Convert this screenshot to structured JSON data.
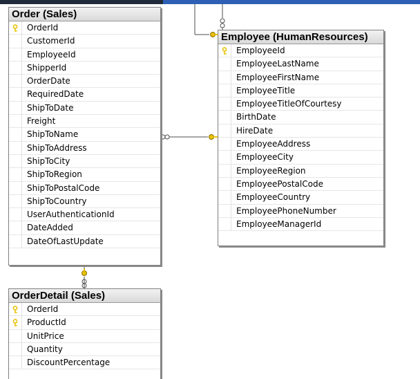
{
  "colors": {
    "key": "#e8c20a",
    "line": "#4d4d4d",
    "header_bg": "#e0e0e0",
    "top_bar": "#1f2b3a",
    "top_bar_accent": "#2e5fb5"
  },
  "order_table": {
    "title": "Order (Sales)",
    "columns": [
      {
        "name": "OrderId",
        "pk": true
      },
      {
        "name": "CustomerId",
        "pk": false
      },
      {
        "name": "EmployeeId",
        "pk": false
      },
      {
        "name": "ShipperId",
        "pk": false
      },
      {
        "name": "OrderDate",
        "pk": false
      },
      {
        "name": "RequiredDate",
        "pk": false
      },
      {
        "name": "ShipToDate",
        "pk": false
      },
      {
        "name": "Freight",
        "pk": false
      },
      {
        "name": "ShipToName",
        "pk": false
      },
      {
        "name": "ShipToAddress",
        "pk": false
      },
      {
        "name": "ShipToCity",
        "pk": false
      },
      {
        "name": "ShipToRegion",
        "pk": false
      },
      {
        "name": "ShipToPostalCode",
        "pk": false
      },
      {
        "name": "ShipToCountry",
        "pk": false
      },
      {
        "name": "UserAuthenticationId",
        "pk": false
      },
      {
        "name": "DateAdded",
        "pk": false
      },
      {
        "name": "DateOfLastUpdate",
        "pk": false
      }
    ]
  },
  "employee_table": {
    "title": "Employee (HumanResources)",
    "columns": [
      {
        "name": "EmployeeId",
        "pk": true
      },
      {
        "name": "EmployeeLastName",
        "pk": false
      },
      {
        "name": "EmployeeFirstName",
        "pk": false
      },
      {
        "name": "EmployeeTitle",
        "pk": false
      },
      {
        "name": "EmployeeTitleOfCourtesy",
        "pk": false
      },
      {
        "name": "BirthDate",
        "pk": false
      },
      {
        "name": "HireDate",
        "pk": false
      },
      {
        "name": "EmployeeAddress",
        "pk": false
      },
      {
        "name": "EmployeeCity",
        "pk": false
      },
      {
        "name": "EmployeeRegion",
        "pk": false
      },
      {
        "name": "EmployeePostalCode",
        "pk": false
      },
      {
        "name": "EmployeeCountry",
        "pk": false
      },
      {
        "name": "EmployeePhoneNumber",
        "pk": false
      },
      {
        "name": "EmployeeManagerId",
        "pk": false
      }
    ]
  },
  "orderdetail_table": {
    "title": "OrderDetail (Sales)",
    "columns": [
      {
        "name": "OrderId",
        "pk": true
      },
      {
        "name": "ProductId",
        "pk": true
      },
      {
        "name": "UnitPrice",
        "pk": false
      },
      {
        "name": "Quantity",
        "pk": false
      },
      {
        "name": "DiscountPercentage",
        "pk": false
      }
    ]
  },
  "relationships": [
    {
      "name": "order-employee",
      "from": "Order (Sales)",
      "to": "Employee (HumanResources)",
      "from_end": "many",
      "to_end": "one"
    },
    {
      "name": "orderdetail-order",
      "from": "OrderDetail (Sales)",
      "to": "Order (Sales)",
      "from_end": "many",
      "to_end": "one"
    },
    {
      "name": "employee-offscreen",
      "from": "Employee (HumanResources)",
      "to": "",
      "from_end": "one",
      "to_end": "many"
    }
  ]
}
